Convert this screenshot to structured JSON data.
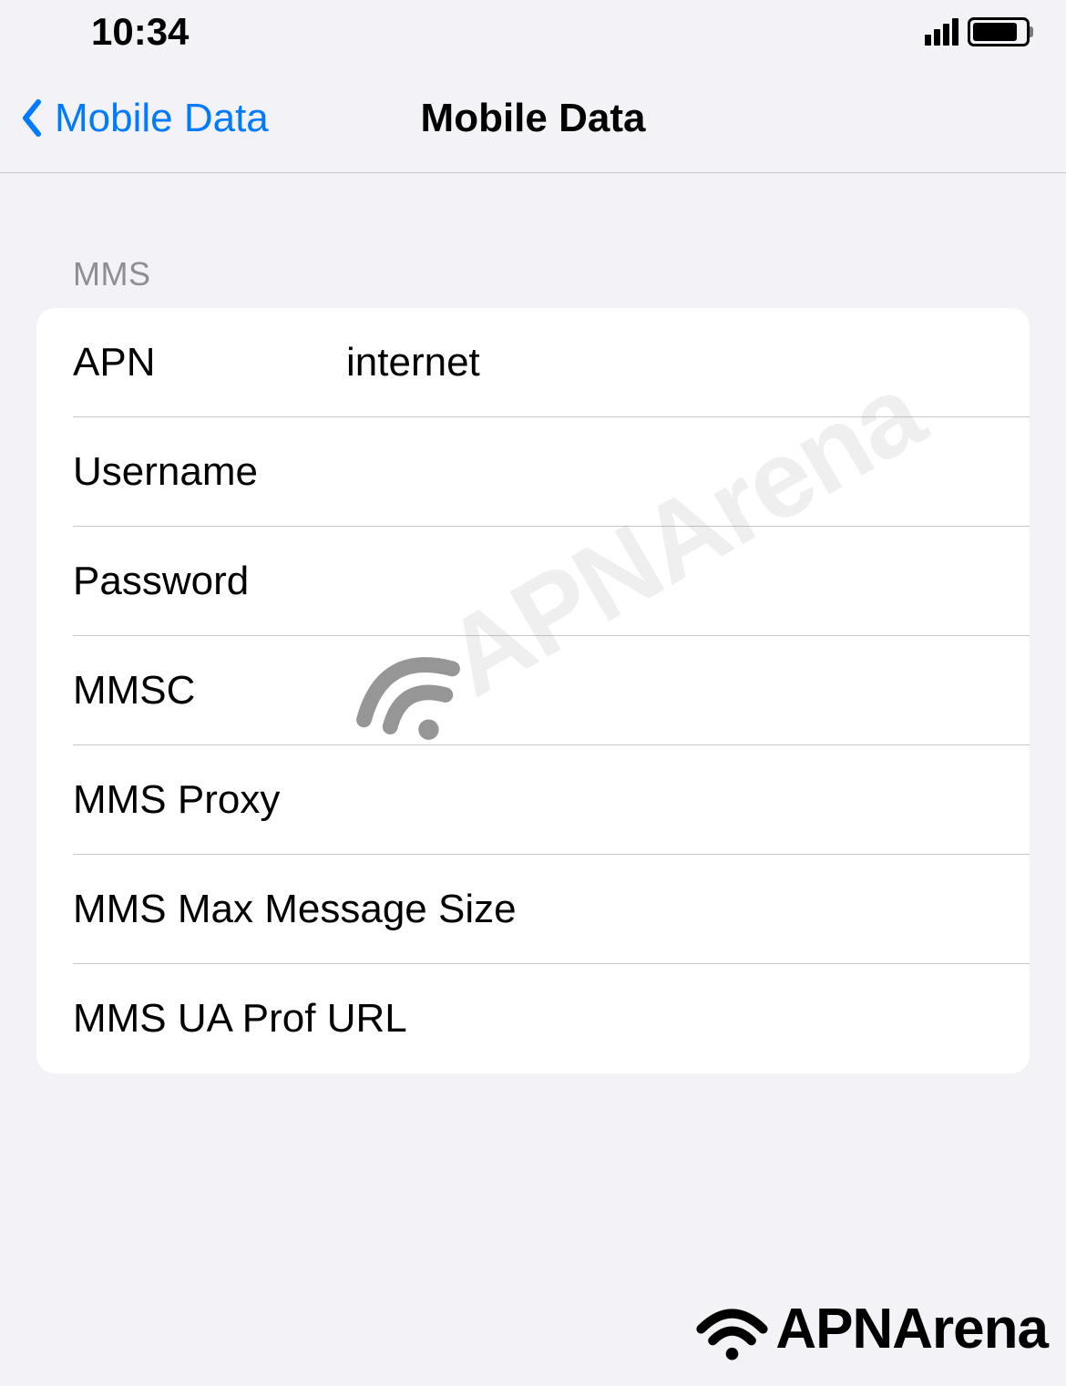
{
  "status_bar": {
    "time": "10:34"
  },
  "nav": {
    "back_label": "Mobile Data",
    "title": "Mobile Data"
  },
  "section": {
    "header": "MMS"
  },
  "fields": {
    "apn": {
      "label": "APN",
      "value": "internet"
    },
    "username": {
      "label": "Username",
      "value": ""
    },
    "password": {
      "label": "Password",
      "value": ""
    },
    "mmsc": {
      "label": "MMSC",
      "value": ""
    },
    "mms_proxy": {
      "label": "MMS Proxy",
      "value": ""
    },
    "mms_max": {
      "label": "MMS Max Message Size",
      "value": ""
    },
    "mms_ua": {
      "label": "MMS UA Prof URL",
      "value": ""
    }
  },
  "watermark": {
    "text": "APNArena"
  },
  "footer": {
    "brand": "APNArena"
  }
}
